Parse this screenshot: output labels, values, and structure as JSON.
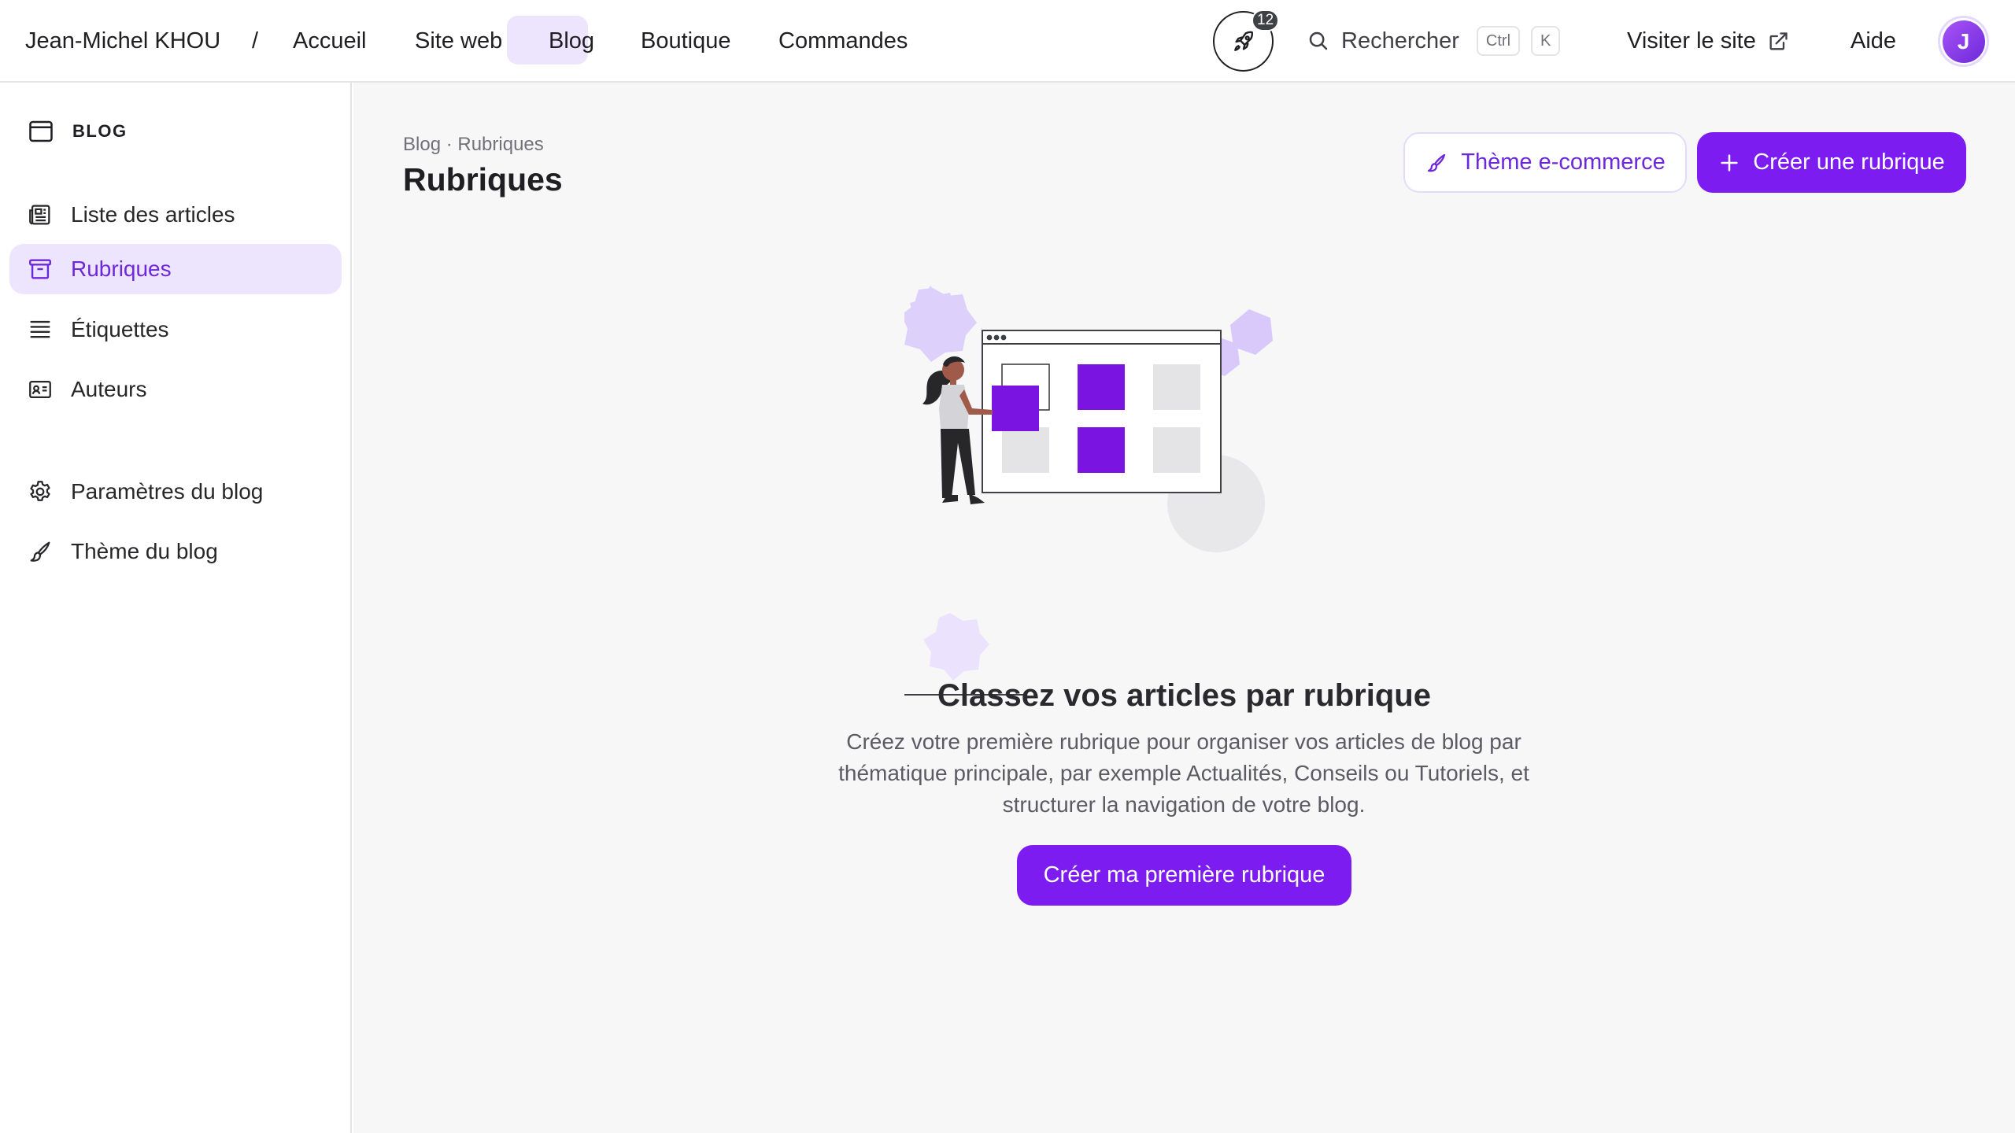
{
  "header": {
    "user": "Jean-Michel KHOU",
    "separator": "/",
    "nav": {
      "home": "Accueil",
      "website": "Site web",
      "blog": "Blog",
      "shop": "Boutique",
      "orders": "Commandes"
    },
    "rocket_badge": "12",
    "search_label": "Rechercher",
    "search_shortcut": [
      "Ctrl",
      "K"
    ],
    "visit_site": "Visiter le site",
    "help": "Aide",
    "avatar_initial": "J",
    "accent_color": "#7c1cf0"
  },
  "sidebar": {
    "section_title": "BLOG",
    "items": [
      {
        "label": "Liste des articles",
        "icon": "newspaper-icon"
      },
      {
        "label": "Rubriques",
        "icon": "archive-box-icon",
        "active": true
      },
      {
        "label": "Étiquettes",
        "icon": "list-lines-icon"
      },
      {
        "label": "Auteurs",
        "icon": "id-card-icon"
      }
    ],
    "settings_items": [
      {
        "label": "Paramètres du blog",
        "icon": "gear-icon"
      },
      {
        "label": "Thème du blog",
        "icon": "paintbrush-icon"
      }
    ]
  },
  "main": {
    "breadcrumb": "Blog · Rubriques",
    "title": "Rubriques",
    "theme_button": "Thème e-commerce",
    "create_button": "Créer une rubrique",
    "empty_state": {
      "title": "Classez vos articles par rubrique",
      "description": "Créez votre première rubrique pour organiser vos articles de blog par thématique principale, par exemple Actualités, Conseils ou Tutoriels, et structurer la navigation de votre blog.",
      "cta": "Créer ma première rubrique"
    }
  }
}
